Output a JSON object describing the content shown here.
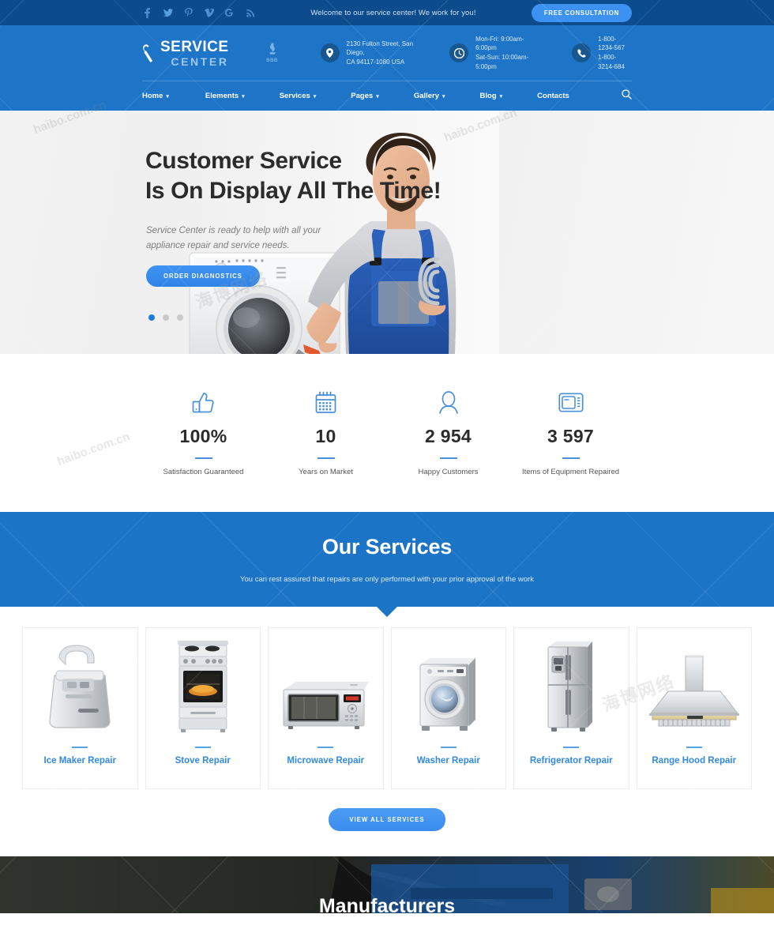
{
  "topbar": {
    "socials": [
      {
        "name": "facebook-icon",
        "glyph": "f"
      },
      {
        "name": "twitter-icon",
        "glyph": "t"
      },
      {
        "name": "pinterest-icon",
        "glyph": "P"
      },
      {
        "name": "vimeo-icon",
        "glyph": "V"
      },
      {
        "name": "google-plus-icon",
        "glyph": "G"
      },
      {
        "name": "rss-icon",
        "glyph": "r"
      }
    ],
    "welcome": "Welcome to our service center! We work for you!",
    "cta_label": "FREE CONSULTATION"
  },
  "header": {
    "logo_top": "SERVICE",
    "logo_bottom": "CENTER",
    "bbb_label": "BBB",
    "address": [
      "2130 Fulton Street, San Diego,",
      "CA 94117-1080 USA"
    ],
    "hours": [
      "Mon-Fri: 9:00am-6:00pm",
      "Sat-Sun: 10:00am-5:00pm"
    ],
    "phones": [
      "1-800-1234-567",
      "1-800-3214-684"
    ]
  },
  "nav": {
    "items": [
      {
        "label": "Home",
        "has_submenu": true
      },
      {
        "label": "Elements",
        "has_submenu": true
      },
      {
        "label": "Services",
        "has_submenu": true
      },
      {
        "label": "Pages",
        "has_submenu": true
      },
      {
        "label": "Gallery",
        "has_submenu": true
      },
      {
        "label": "Blog",
        "has_submenu": true
      },
      {
        "label": "Contacts",
        "has_submenu": false
      }
    ]
  },
  "hero": {
    "title_line1": "Customer Service",
    "title_line2": "Is On Display All The Time!",
    "subtitle_line1": "Service Center is ready to help with all your",
    "subtitle_line2": "appliance repair and service needs.",
    "button_label": "ORDER DIAGNOSTICS",
    "slides_total": 3,
    "active_slide": 1
  },
  "stats": [
    {
      "icon": "thumbs-up-icon",
      "number": "100%",
      "label": "Satisfaction Guaranteed"
    },
    {
      "icon": "calendar-icon",
      "number": "10",
      "label": "Years on Market"
    },
    {
      "icon": "user-icon",
      "number": "2 954",
      "label": "Happy Customers"
    },
    {
      "icon": "microwave-icon",
      "number": "3 597",
      "label": "Items of Equipment Repaired"
    }
  ],
  "services_banner": {
    "title": "Our Services",
    "subtitle": "You can rest assured that repairs are only performed with your prior approval of the work"
  },
  "service_cards": [
    {
      "title": "Ice Maker Repair",
      "image": "ice-maker"
    },
    {
      "title": "Stove Repair",
      "image": "stove"
    },
    {
      "title": "Microwave Repair",
      "image": "microwave"
    },
    {
      "title": "Washer Repair",
      "image": "washer"
    },
    {
      "title": "Refrigerator Repair",
      "image": "refrigerator"
    },
    {
      "title": "Range Hood Repair",
      "image": "range-hood"
    }
  ],
  "view_all_label": "VIEW ALL SERVICES",
  "manufacturers": {
    "title": "Manufacturers"
  },
  "colors": {
    "topbar_bg": "#0d4c8c",
    "header_bg": "#1e75c8",
    "banner_bg": "#1b74c6",
    "accent": "#3189e0",
    "button": "#3d91f0",
    "stat_rule": "#4a90d9"
  },
  "watermarks": [
    "haibo.com.cn",
    "haibo.com.cn",
    "海博网络",
    "haibo.com.cn",
    "海博网络"
  ]
}
